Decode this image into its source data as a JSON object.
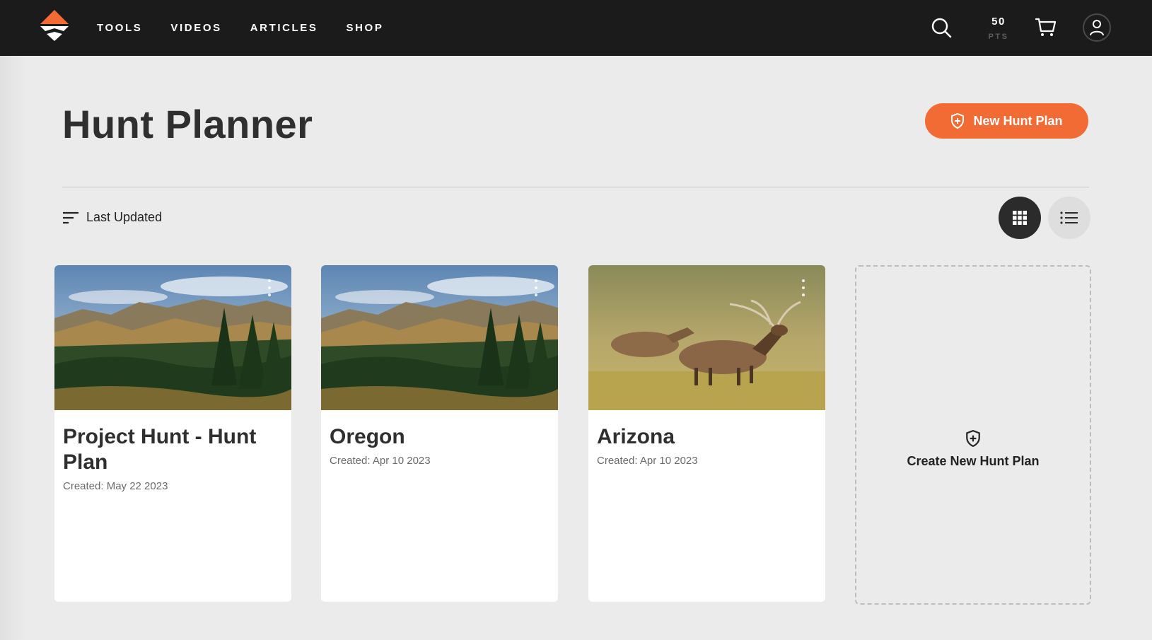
{
  "nav": {
    "links": [
      "TOOLS",
      "VIDEOS",
      "ARTICLES",
      "SHOP"
    ],
    "points_value": "50",
    "points_label": "PTS"
  },
  "header": {
    "title": "Hunt Planner",
    "new_plan_label": "New Hunt Plan"
  },
  "toolbar": {
    "sort_label": "Last Updated"
  },
  "plans": [
    {
      "title": "Project Hunt - Hunt Plan",
      "created": "Created: May 22 2023",
      "image": "mountain-forest"
    },
    {
      "title": "Oregon",
      "created": "Created: Apr 10 2023",
      "image": "mountain-forest"
    },
    {
      "title": "Arizona",
      "created": "Created: Apr 10 2023",
      "image": "elk-meadow"
    }
  ],
  "create_card": {
    "label": "Create New Hunt Plan"
  },
  "colors": {
    "accent": "#f26a34",
    "nav_bg": "#1b1b1b",
    "page_bg": "#ebebeb"
  }
}
